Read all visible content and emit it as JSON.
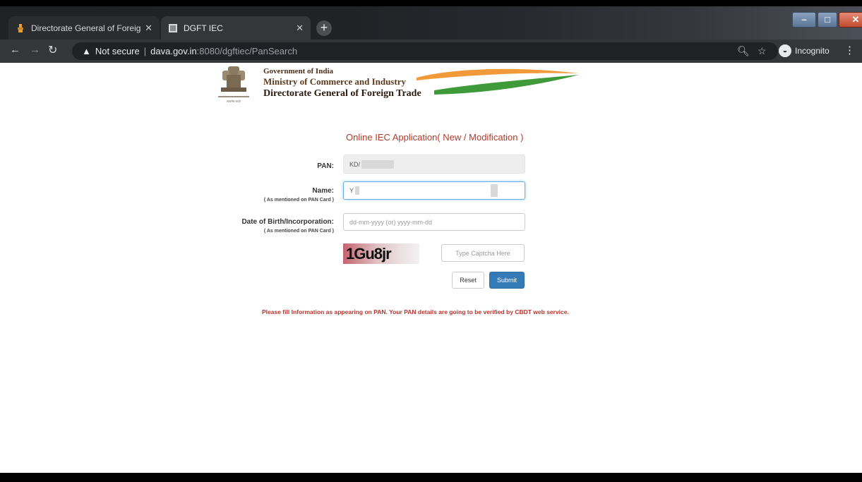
{
  "browser": {
    "tabs": [
      {
        "title": "Directorate General of Foreign Tr",
        "active": false
      },
      {
        "title": "DGFT IEC",
        "active": true
      }
    ],
    "new_tab": "+",
    "address": {
      "security": "Not secure",
      "host": "dava.gov.in",
      "path": ":8080/dgftiec/PanSearch"
    },
    "profile": "Incognito"
  },
  "header": {
    "line1": "Government of India",
    "line2": "Ministry of Commerce and Industry",
    "line3": "Directorate General of Foreign Trade",
    "emblem_caption": "सत्यमेव जयते"
  },
  "form": {
    "title": "Online IEC Application( New / Modification )",
    "pan": {
      "label": "PAN:",
      "value": "KD/"
    },
    "name": {
      "label": "Name:",
      "sublabel": "( As mentioned on PAN Card )",
      "value": "Y"
    },
    "dob": {
      "label": "Date of Birth/Incorporation:",
      "sublabel": "( As mentioned on PAN Card )",
      "placeholder": "dd-mm-yyyy  (or)  yyyy-mm-dd"
    },
    "captcha": {
      "text": "1Gu8jr",
      "placeholder": "Type Captcha Here"
    },
    "reset_label": "Reset",
    "submit_label": "Submit"
  },
  "note": "Please fill Information as appearing on PAN. Your PAN details are going to be verified by CBDT web service."
}
